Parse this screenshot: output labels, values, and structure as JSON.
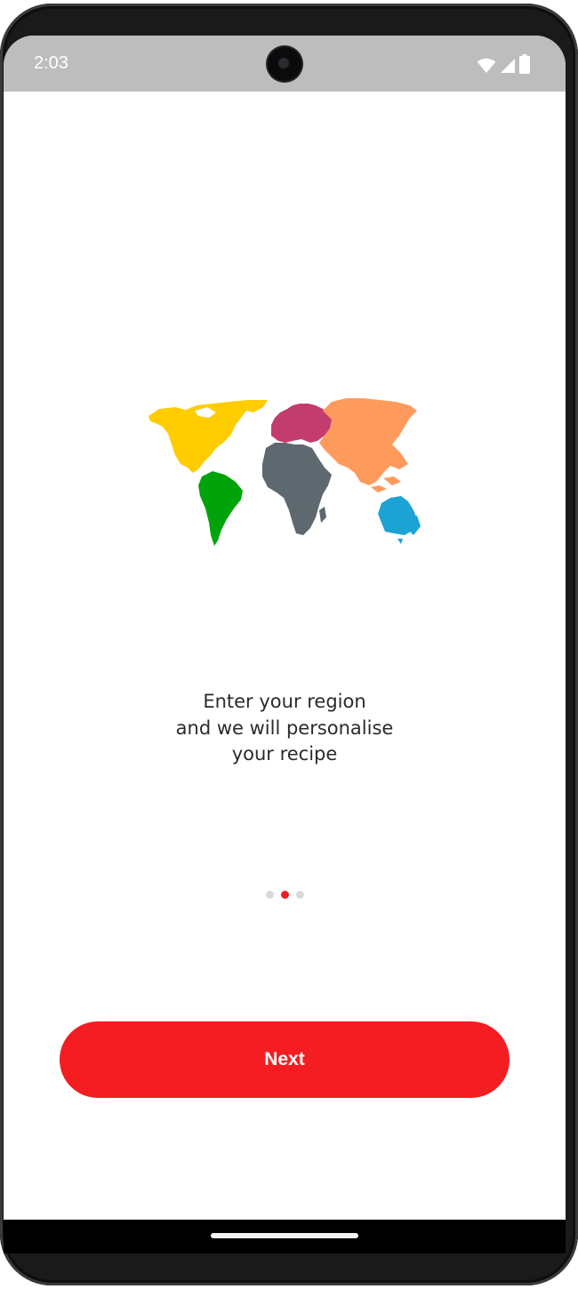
{
  "status_bar": {
    "time": "2:03",
    "icons": [
      "wifi-icon",
      "cellular-signal-icon",
      "battery-icon"
    ]
  },
  "illustration": {
    "icon": "world-map-icon",
    "continent_colors": {
      "north_america": "#ffcc00",
      "south_america": "#00a40a",
      "europe": "#c33c6e",
      "africa": "#5d686f",
      "asia": "#ff9a5d",
      "australia": "#1ba3d3"
    }
  },
  "onboarding": {
    "message_lines": [
      "Enter your region",
      "and we will personalise",
      "your recipe"
    ],
    "page_count": 3,
    "current_page": 2
  },
  "actions": {
    "next_label": "Next"
  },
  "colors": {
    "accent": "#f41e22",
    "status_bar_bg": "#bdbdbd",
    "dot_inactive": "#d9d9d9",
    "dot_active": "#ee1c24"
  }
}
